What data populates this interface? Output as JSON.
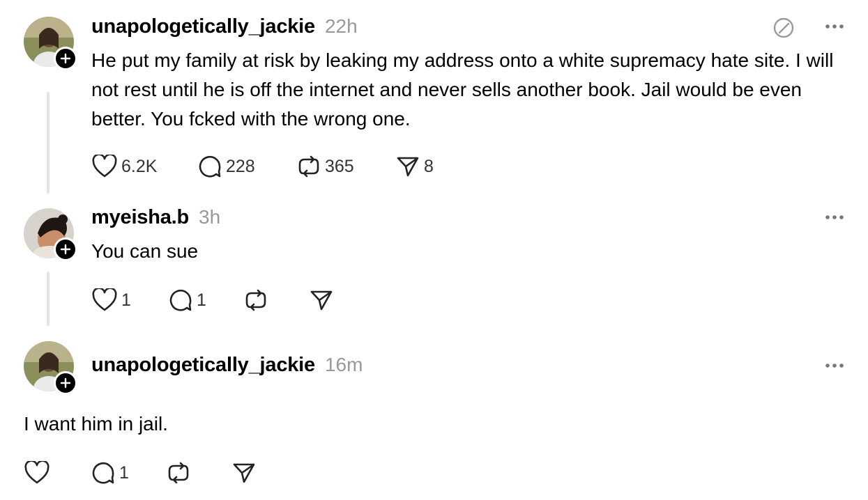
{
  "posts": [
    {
      "username": "unapologetically_jackie",
      "time": "22h",
      "text": "He put my family at risk by leaking my address onto a white supremacy hate site. I will not rest until he is off the internet and never sells another book. Jail would be even better. You fcked with the wrong one.",
      "likes": "6.2K",
      "replies": "228",
      "reposts": "365",
      "shares": "8"
    },
    {
      "username": "myeisha.b",
      "time": "3h",
      "text": "You can sue",
      "likes": "1",
      "replies": "1",
      "reposts": "",
      "shares": ""
    },
    {
      "username": "unapologetically_jackie",
      "time": "16m",
      "text": "I want him in jail.",
      "likes": "",
      "replies": "1",
      "reposts": "",
      "shares": ""
    }
  ],
  "icons": {
    "like": "heart-icon",
    "reply": "comment-icon",
    "repost": "repost-icon",
    "share": "send-icon",
    "more": "more-icon",
    "edit": "edit-icon",
    "follow": "plus-icon"
  },
  "colors": {
    "text": "#000000",
    "muted": "#999999",
    "thread_line": "#e5e5e5"
  }
}
